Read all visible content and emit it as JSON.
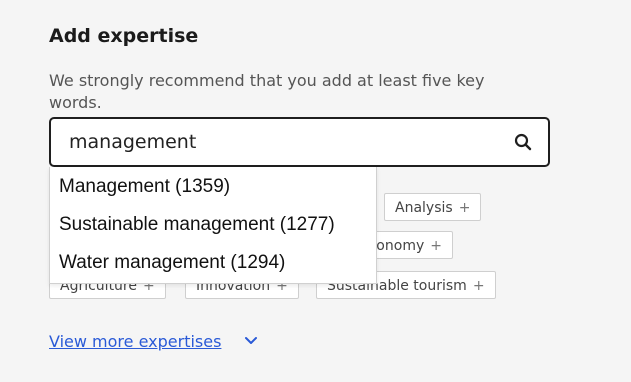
{
  "heading": "Add expertise",
  "help_text": "We strongly recommend that you add at least five key words.",
  "search": {
    "value": "management",
    "icon": "search-icon"
  },
  "suggestions": [
    "Management (1359)",
    "Sustainable management (1277)",
    "Water management (1294)"
  ],
  "tags": [
    {
      "label": "Analysis",
      "plus": "+"
    },
    {
      "label": "economy",
      "plus": "+"
    },
    {
      "label": "Agriculture",
      "plus": "+"
    },
    {
      "label": "Innovation",
      "plus": "+"
    },
    {
      "label": "Sustainable tourism",
      "plus": "+"
    }
  ],
  "more_link": "View more expertises",
  "colors": {
    "link": "#2a5ad7",
    "border": "#1f1f1f"
  }
}
